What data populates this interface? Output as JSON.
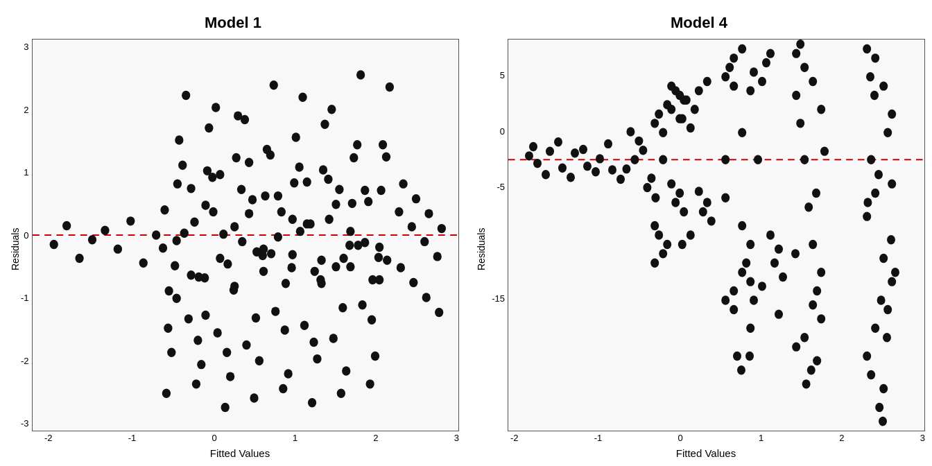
{
  "charts": [
    {
      "id": "model1",
      "title": "Model 1",
      "y_label": "Residuals",
      "x_label": "Fitted Values",
      "y_ticks": [
        "3",
        "2",
        "1",
        "0",
        "-1",
        "-2",
        "-3"
      ],
      "x_ticks": [
        "-2",
        "-1",
        "0",
        "1",
        "2",
        "3"
      ],
      "y_min": -3.5,
      "y_max": 3.5,
      "x_min": -2.2,
      "x_max": 3.7,
      "dashed_line_y": 0
    },
    {
      "id": "model4",
      "title": "Model 4",
      "y_label": "Residuals",
      "x_label": "Fitted Values",
      "y_ticks": [
        "5",
        "0",
        "-5",
        "-15"
      ],
      "x_ticks": [
        "-2",
        "-1",
        "0",
        "1",
        "2",
        "3"
      ],
      "y_min": -18,
      "y_max": 8,
      "x_min": -2.2,
      "x_max": 3.7,
      "dashed_line_y": 0
    }
  ]
}
